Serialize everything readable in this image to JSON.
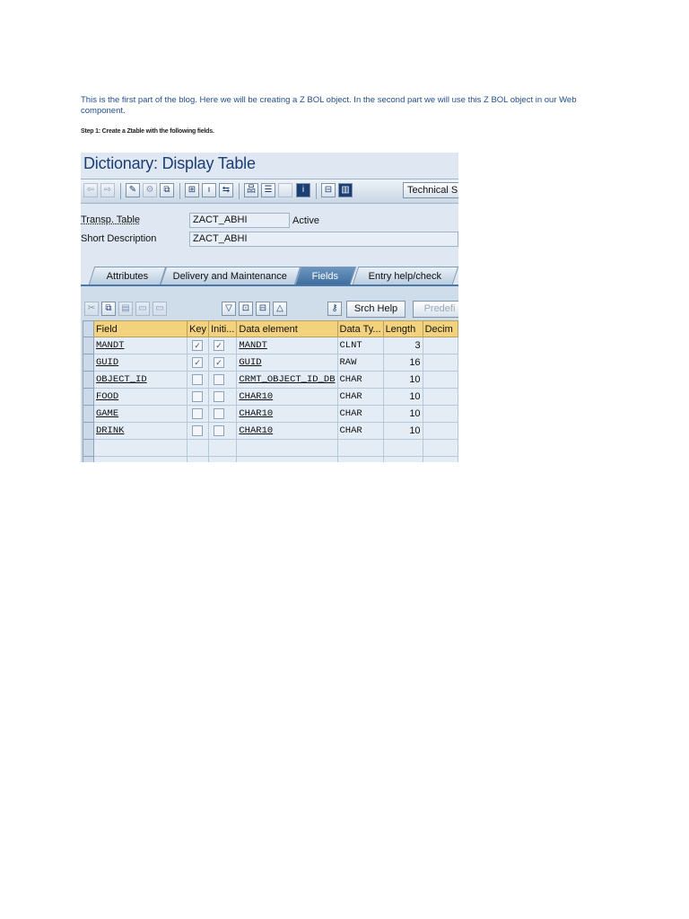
{
  "intro_text": "This is the first part of the blog. Here we will be creating a Z BOL object. In the second part we will use this Z BOL object in our Web component.",
  "step_text": "Step 1: Create a Ztable with the following fields.",
  "screenshot": {
    "title": "Dictionary: Display Table",
    "toolbar": {
      "technical_button": "Technical S"
    },
    "header": {
      "transp_table_label": "Transp. Table",
      "transp_table_value": "ZACT_ABHI",
      "status": "Active",
      "short_desc_label": "Short Description",
      "short_desc_value": "ZACT_ABHI"
    },
    "tabs": [
      {
        "label": "Attributes",
        "active": false
      },
      {
        "label": "Delivery and Maintenance",
        "active": false
      },
      {
        "label": "Fields",
        "active": true
      },
      {
        "label": "Entry help/check",
        "active": false
      }
    ],
    "field_toolbar": {
      "srch_help": "Srch Help",
      "predefined": "Predefi"
    },
    "columns": [
      "Field",
      "Key",
      "Initi...",
      "Data element",
      "Data Ty...",
      "Length",
      "Decim"
    ],
    "rows": [
      {
        "field": "MANDT",
        "key": true,
        "init": true,
        "data_element": "MANDT",
        "data_type": "CLNT",
        "length": "3"
      },
      {
        "field": "GUID",
        "key": true,
        "init": true,
        "data_element": "GUID",
        "data_type": "RAW",
        "length": "16"
      },
      {
        "field": "OBJECT_ID",
        "key": false,
        "init": false,
        "data_element": "CRMT_OBJECT_ID_DB",
        "data_type": "CHAR",
        "length": "10"
      },
      {
        "field": "FOOD",
        "key": false,
        "init": false,
        "data_element": "CHAR10",
        "data_type": "CHAR",
        "length": "10"
      },
      {
        "field": "GAME",
        "key": false,
        "init": false,
        "data_element": "CHAR10",
        "data_type": "CHAR",
        "length": "10"
      },
      {
        "field": "DRINK",
        "key": false,
        "init": false,
        "data_element": "CHAR10",
        "data_type": "CHAR",
        "length": "10"
      }
    ],
    "colors": {
      "title": "#1b3e74",
      "header_row": "#f3d27e",
      "active_tab": "#3f6e9f",
      "intro_text": "#1f4e8c"
    }
  }
}
